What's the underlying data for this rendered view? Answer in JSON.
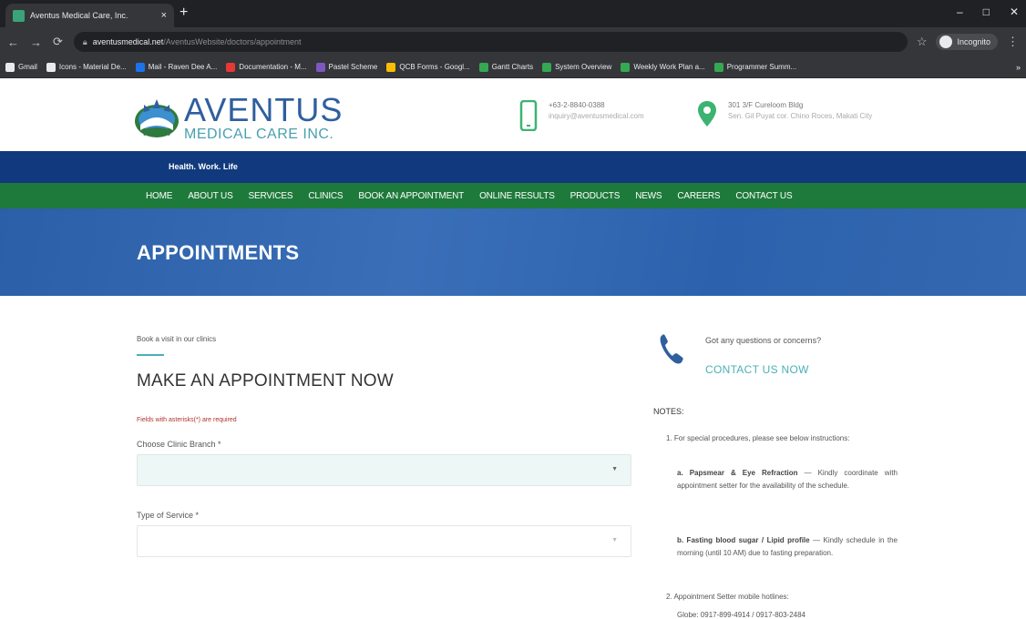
{
  "browser": {
    "tab_title": "Aventus Medical Care, Inc.",
    "tab_close": "×",
    "new_tab": "+",
    "window_controls": [
      "–",
      "□",
      "✕"
    ],
    "url_host": "aventusmedical.net",
    "url_path": "/AventusWebsite/doctors/appointment",
    "profile_label": "Incognito",
    "bookmarks": [
      {
        "label": "Gmail",
        "color": "#e8eaed"
      },
      {
        "label": "Icons - Material De...",
        "color": "#e8eaed"
      },
      {
        "label": "Mail - Raven Dee A...",
        "color": "#1a73e8"
      },
      {
        "label": "Documentation - M...",
        "color": "#e53935"
      },
      {
        "label": "Pastel Scheme",
        "color": "#7e57c2"
      },
      {
        "label": "QCB Forms - Googl...",
        "color": "#fbbc04"
      },
      {
        "label": "Gantt Charts",
        "color": "#34a853"
      },
      {
        "label": "System Overview",
        "color": "#34a853"
      },
      {
        "label": "Weekly Work Plan a...",
        "color": "#34a853"
      },
      {
        "label": "Programmer Summ...",
        "color": "#34a853"
      }
    ]
  },
  "site": {
    "logo_line1": "AVENTUS",
    "logo_line2": "MEDICAL CARE INC.",
    "phone": "+63-2-8840-0388",
    "email": "inquiry@aventusmedical.com",
    "address_line1": "301 3/F Cureloom Bldg",
    "address_line2": "Sen. Gil Puyat cor. Chino Roces, Makati City",
    "tagline": "Health. Work. Life",
    "nav": [
      "HOME",
      "ABOUT US",
      "SERVICES",
      "CLINICS",
      "BOOK AN APPOINTMENT",
      "ONLINE RESULTS",
      "PRODUCTS",
      "NEWS",
      "CAREERS",
      "CONTACT US"
    ],
    "hero_title": "APPOINTMENTS"
  },
  "form": {
    "kicker": "Book a visit in our clinics",
    "title": "MAKE AN APPOINTMENT NOW",
    "required_note": "Fields with asterisks(*) are required",
    "branch_label": "Choose Clinic Branch *",
    "branch_value": "",
    "service_label": "Type of Service *",
    "service_value": ""
  },
  "sidebar": {
    "ask": "Got any questions or concerns?",
    "contact_now": "CONTACT US NOW",
    "notes_heading": "NOTES:",
    "note1": "1. For special procedures, please see below instructions:",
    "note_a_title": "a. Papsmear & Eye Refraction",
    "note_a_text": " — Kindly coordinate with appointment setter for the availability of the schedule.",
    "note_b_title": "b. Fasting blood sugar / Lipid profile",
    "note_b_text": " — Kindly schedule in the morning (until 10 AM) due to fasting preparation.",
    "note2": "2. Appointment Setter mobile hotlines:",
    "note2_globe": "Globe: 0917-899-4914 / 0917-803-2484"
  },
  "colors": {
    "brand_blue": "#103a7d",
    "nav_green": "#1e7a3a",
    "accent_teal": "#4ab0b7",
    "hero_blue": "#2f62aa"
  }
}
